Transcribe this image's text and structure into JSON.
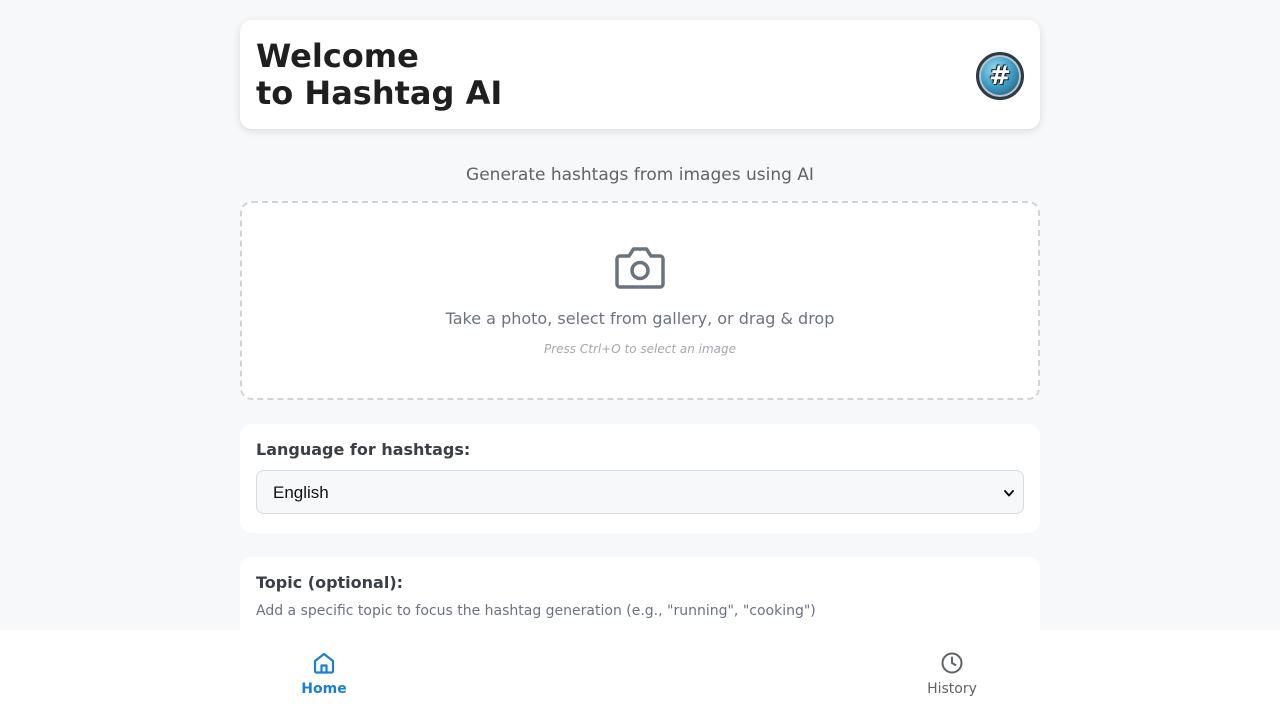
{
  "header": {
    "title_line1": "Welcome",
    "title_line2": "to Hashtag AI",
    "logo_icon": "hashtag-logo-icon",
    "logo_glyph": "#"
  },
  "subtitle": "Generate hashtags from images using AI",
  "upload": {
    "icon": "camera-icon",
    "text": "Take a photo, select from gallery, or drag & drop",
    "hint": "Press Ctrl+O to select an image"
  },
  "language": {
    "label": "Language for hashtags:",
    "selected": "English"
  },
  "topic": {
    "label": "Topic (optional):",
    "help": "Add a specific topic to focus the hashtag generation (e.g., \"running\", \"cooking\")"
  },
  "nav": {
    "home_label": "Home",
    "history_label": "History",
    "active": "Home",
    "active_color": "#1a7fd6",
    "inactive_color": "#5f6368"
  }
}
